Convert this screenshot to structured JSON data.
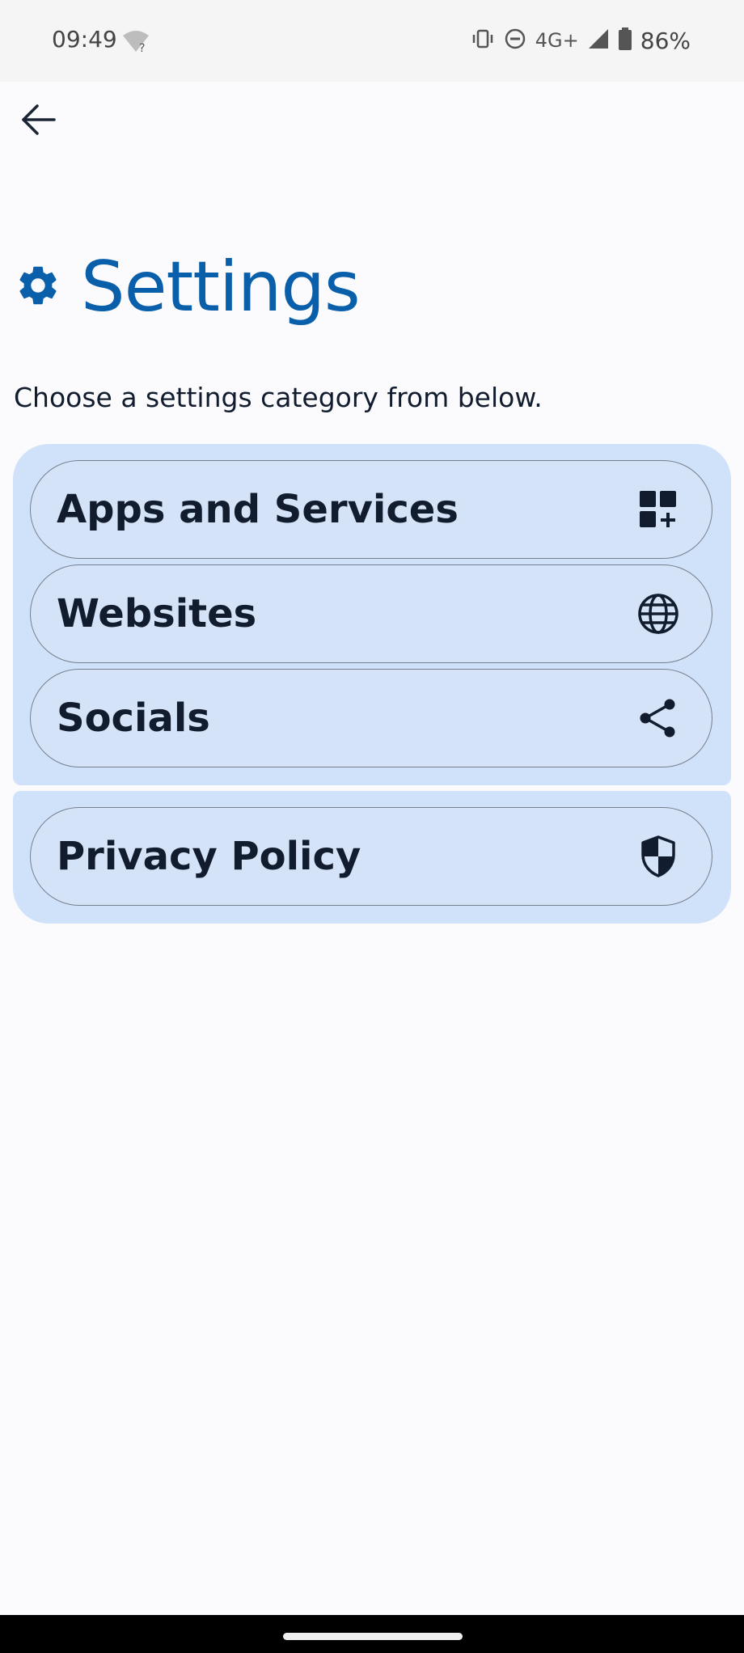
{
  "status_bar": {
    "time": "09:49",
    "network": "4G+",
    "battery": "86%"
  },
  "header": {
    "back_icon": "arrow-left-icon"
  },
  "page": {
    "title": "Settings",
    "title_icon": "gear-icon",
    "subtitle": "Choose a settings category from below."
  },
  "settings_groups": [
    {
      "items": [
        {
          "label": "Apps and Services",
          "icon": "apps-add-icon"
        },
        {
          "label": "Websites",
          "icon": "globe-icon"
        },
        {
          "label": "Socials",
          "icon": "share-icon"
        }
      ]
    },
    {
      "items": [
        {
          "label": "Privacy Policy",
          "icon": "shield-icon"
        }
      ]
    }
  ],
  "colors": {
    "accent": "#0a5faa",
    "group_background": "#d0e1fa",
    "text": "#111d2e",
    "page_background": "#fbfbfe"
  }
}
